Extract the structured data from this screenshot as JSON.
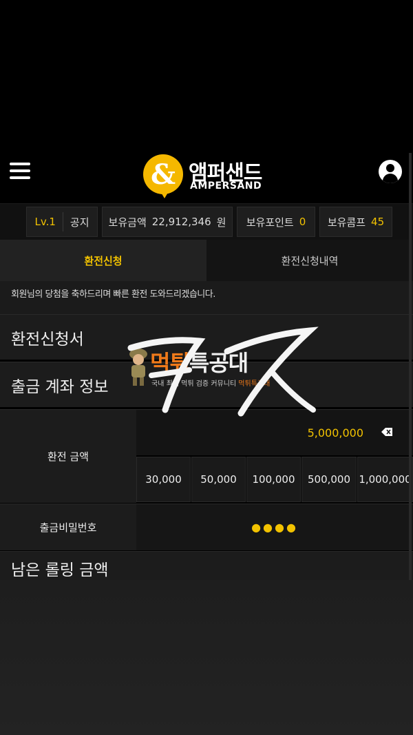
{
  "header": {
    "logo_text_ko": "앰퍼샌드",
    "logo_text_en": "AMPERSAND",
    "logo_symbol": "&",
    "menu_icon": "hamburger-menu-icon",
    "user_icon": "user-account-icon"
  },
  "info_bar": {
    "level": "Lv.1",
    "notice": "공지",
    "balance_label": "보유금액",
    "balance_value": "22,912,346",
    "balance_unit": "원",
    "points_label": "보유포인트",
    "points_value": "0",
    "comp_label": "보유콤프",
    "comp_value": "45"
  },
  "tabs": [
    {
      "label": "환전신청",
      "active": true
    },
    {
      "label": "환전신청내역",
      "active": false
    }
  ],
  "notice_text": "회원님의 당첨을 축하드리며 빠른 환전 도와드리겠습니다.",
  "sections": {
    "form_title": "환전신청서",
    "account_title": "출금 계좌 정보",
    "rolling_title": "남은 롤링 금액"
  },
  "form": {
    "amount_label": "환전 금액",
    "amount_value": "5,000,000",
    "quick_amounts": [
      "30,000",
      "50,000",
      "100,000",
      "500,000",
      "1,000,000"
    ],
    "password_label": "출금비밀번호",
    "password_value": "●●●●"
  },
  "watermark": {
    "title_a": "먹튀",
    "title_b": "특공대",
    "subtitle_a": "국내 최대 먹튀 검증 커뮤니티 ",
    "subtitle_b": "먹튀특공대"
  },
  "colors": {
    "accent": "#f2c200",
    "logo_yellow": "#f5b800",
    "background": "#1c1c1c"
  }
}
